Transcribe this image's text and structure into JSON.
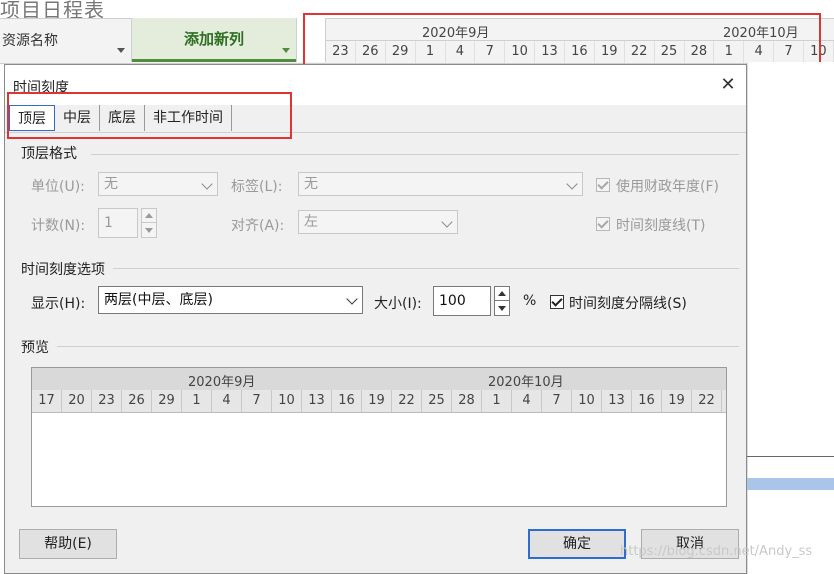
{
  "background": {
    "title_fragment": "项目日程表",
    "col_resource": "资源名称",
    "col_add": "添加新列",
    "timescale": {
      "months": [
        "2020年9月",
        "2020年10月"
      ],
      "days": [
        "23",
        "26",
        "29",
        "1",
        "4",
        "7",
        "10",
        "13",
        "16",
        "19",
        "22",
        "25",
        "28",
        "1",
        "4",
        "7",
        "10"
      ]
    }
  },
  "dialog": {
    "title": "时间刻度",
    "close_glyph": "✕",
    "tabs": [
      "顶层",
      "中层",
      "底层",
      "非工作时间"
    ],
    "top_format": {
      "heading": "顶层格式",
      "unit_label": "单位(U):",
      "unit_value": "无",
      "label_label": "标签(L):",
      "label_value": "无",
      "fiscal_year_label": "使用财政年度(F)",
      "count_label": "计数(N):",
      "count_value": "1",
      "align_label": "对齐(A):",
      "align_value": "左",
      "tick_lines_label": "时间刻度线(T)"
    },
    "options": {
      "heading": "时间刻度选项",
      "show_label": "显示(H):",
      "show_value": "两层(中层、底层)",
      "size_label": "大小(I):",
      "size_value": "100",
      "size_unit": "%",
      "separator_label": "时间刻度分隔线(S)"
    },
    "preview": {
      "heading": "预览",
      "months": [
        "2020年9月",
        "2020年10月"
      ],
      "days": [
        "17",
        "20",
        "23",
        "26",
        "29",
        "1",
        "4",
        "7",
        "10",
        "13",
        "16",
        "19",
        "22",
        "25",
        "28",
        "1",
        "4",
        "7",
        "10",
        "13",
        "16",
        "19",
        "22"
      ]
    },
    "buttons": {
      "help": "帮助(E)",
      "ok": "确定",
      "cancel": "取消"
    }
  },
  "watermark": "https://blog.csdn.net/Andy_ss"
}
